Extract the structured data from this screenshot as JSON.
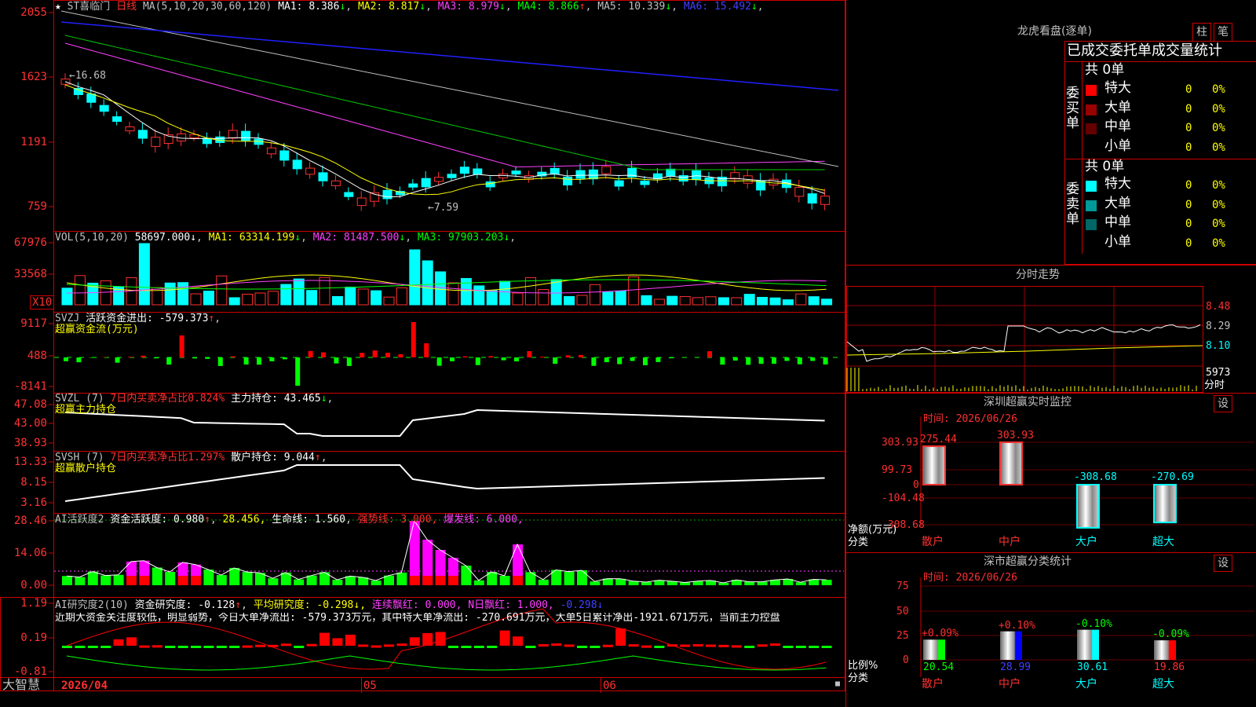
{
  "main": {
    "stock_name": "ST喜临门",
    "period": "日线",
    "ma_title": "MA(5,10,20,30,60,120)",
    "ma": [
      {
        "label": "MA1:",
        "value": "8.386",
        "arrow": "↓",
        "color": "#ffffff"
      },
      {
        "label": "MA2:",
        "value": "8.817",
        "arrow": "↓",
        "color": "#ffff00"
      },
      {
        "label": "MA3:",
        "value": "8.979",
        "arrow": "↓",
        "color": "#ff40ff"
      },
      {
        "label": "MA4:",
        "value": "8.866",
        "arrow": "↑",
        "color": "#00ff00"
      },
      {
        "label": "MA5:",
        "value": "10.339",
        "arrow": "↓",
        "color": "#c0c0c0"
      },
      {
        "label": "MA6:",
        "value": "15.492",
        "arrow": "↓",
        "color": "#4040ff"
      }
    ],
    "high_mark": "16.68",
    "low_mark": "7.59",
    "yticks": [
      "2055",
      "1623",
      "1191",
      "759"
    ],
    "star_marks": "★"
  },
  "vol": {
    "title": "VOL(5,10,20)",
    "value": "58697.000",
    "ma": [
      {
        "label": "MA1:",
        "value": "63314.199",
        "arrow": "↓",
        "color": "#ffff00"
      },
      {
        "label": "MA2:",
        "value": "81487.500",
        "arrow": "↓",
        "color": "#ff40ff"
      },
      {
        "label": "MA3:",
        "value": "97903.203",
        "arrow": "↓",
        "color": "#00ff00"
      }
    ],
    "yticks": [
      "67976",
      "33568"
    ],
    "unit": "X10"
  },
  "svzj": {
    "title": "SVZJ",
    "line1_label": "活跃资金进出:",
    "line1_value": "-579.373",
    "line1_arrow": "↑",
    "line2": "超赢资金流(万元)",
    "yticks": [
      "9117",
      "488",
      "-8141"
    ]
  },
  "svzl": {
    "title": "SVZL (7)",
    "desc": "7日内买卖净占比0.824%",
    "label": "主力持仓:",
    "value": "43.465",
    "arrow": "↓",
    "sub": "超赢主力持仓",
    "yticks": [
      "47.08",
      "43.00",
      "38.93"
    ]
  },
  "svsh": {
    "title": "SVSH (7)",
    "desc": "7日内买卖净占比1.297%",
    "label": "散户持仓:",
    "value": "9.044",
    "arrow": "↑",
    "sub": "超赢散户持仓",
    "yticks": [
      "13.33",
      "8.15",
      "3.16"
    ]
  },
  "ai_active": {
    "title": "AI活跃度2",
    "label": "资金活跃度:",
    "value": "0.980",
    "arrow": "↑",
    "v2": "28.456",
    "life_label": "生命线:",
    "life_value": "1.560",
    "strong": "强势线: 3.000",
    "burst": "爆发线: 6.000",
    "yticks": [
      "28.46",
      "14.06",
      "0.00"
    ]
  },
  "ai_research": {
    "title": "AI研究度2(10)",
    "label": "资金研究度:",
    "value": "-0.128",
    "arrow": "↑",
    "avg": "平均研究度: -0.298",
    "avg_arrow": "↓",
    "red": "连续飘红: 0.000",
    "nred": "N日飘红: 1.000",
    "last": "-0.298",
    "last_arrow": "↓",
    "comment": "近期大资金关注度较低，明显弱势，今日大单净流出: -579.373万元，其中特大单净流出: -270.691万元，大单5日累计净出-1921.671万元，当前主力控盘",
    "yticks": [
      "1.19",
      "0.19",
      "-0.81"
    ]
  },
  "bottom": {
    "logo": "大智慧",
    "date": "2026/04",
    "months": [
      "05",
      "06"
    ]
  },
  "right": {
    "dragon_title": "龙虎看盘(逐单)",
    "tab_zhu": "柱",
    "tab_bi": "笔",
    "stats_header": "已成交委托单成交量统计",
    "buy": {
      "side": "委买单",
      "total": "共 0单",
      "rows": [
        {
          "name": "特大",
          "count": "0",
          "pct": "0%",
          "color": "#ff0000"
        },
        {
          "name": "大单",
          "count": "0",
          "pct": "0%",
          "color": "#990000"
        },
        {
          "name": "中单",
          "count": "0",
          "pct": "0%",
          "color": "#660000"
        },
        {
          "name": "小单",
          "count": "0",
          "pct": "0%",
          "color": "#000000"
        }
      ]
    },
    "sell": {
      "side": "委卖单",
      "total": "共 0单",
      "rows": [
        {
          "name": "特大",
          "count": "0",
          "pct": "0%",
          "color": "#00ffff"
        },
        {
          "name": "大单",
          "count": "0",
          "pct": "0%",
          "color": "#009999"
        },
        {
          "name": "中单",
          "count": "0",
          "pct": "0%",
          "color": "#006666"
        },
        {
          "name": "小单",
          "count": "0",
          "pct": "0%",
          "color": "#000000"
        }
      ]
    },
    "intraday_title": "分时走势",
    "intraday_yticks": [
      "8.48",
      "8.29",
      "8.10"
    ],
    "intraday_vol": "5973",
    "intraday_unit": "分时",
    "monitor_title": "深圳超赢实时监控",
    "monitor_set": "设",
    "monitor_time": "时间: 2026/06/26",
    "monitor_yticks": [
      "303.93",
      "99.73",
      "0",
      "-104.48",
      "-308.68"
    ],
    "monitor_ylabel1": "净额(万元)",
    "monitor_ylabel2": "分类",
    "monitor_bars": [
      {
        "cat": "散户",
        "value": "275.44",
        "cat_color": "#ff3030"
      },
      {
        "cat": "中户",
        "value": "303.93",
        "cat_color": "#ff3030"
      },
      {
        "cat": "大户",
        "value": "-308.68",
        "cat_color": "#00ffff"
      },
      {
        "cat": "超大",
        "value": "-270.69",
        "cat_color": "#00ffff"
      }
    ],
    "class_title": "深市超赢分类统计",
    "class_set": "设",
    "class_time": "时间: 2026/06/26",
    "class_yticks": [
      "75",
      "50",
      "25",
      "0"
    ],
    "class_ylabel1": "比例%",
    "class_ylabel2": "分类",
    "class_bars": [
      {
        "cat": "散户",
        "pct": "20.54",
        "change": "+0.09%",
        "color": "#00ff00"
      },
      {
        "cat": "中户",
        "pct": "28.99",
        "change": "+0.10%",
        "color": "#0000ff"
      },
      {
        "cat": "大户",
        "pct": "30.61",
        "change": "-0.10%",
        "color": "#00ffff"
      },
      {
        "cat": "超大",
        "pct": "19.86",
        "change": "-0.09%",
        "color": "#ff0000"
      }
    ]
  }
}
